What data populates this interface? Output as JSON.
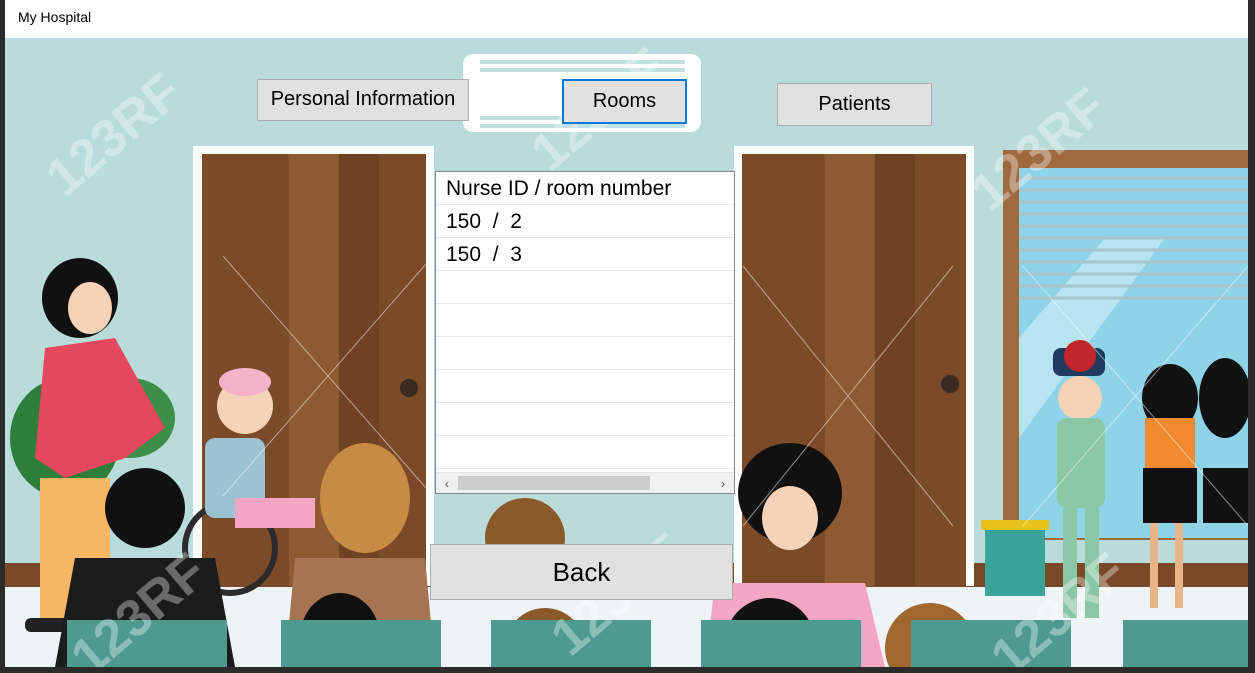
{
  "window": {
    "title": "My Hospital"
  },
  "nav": {
    "personal_label": "Personal Information",
    "rooms_label": "Rooms",
    "patients_label": "Patients"
  },
  "rooms_list": {
    "rows": [
      "Nurse ID / room number",
      "150  /  2",
      "150  /  3",
      "",
      "",
      "",
      "",
      "",
      ""
    ]
  },
  "back_label": "Back",
  "watermark": "123RF",
  "colors": {
    "selected_border": "#0078d7",
    "button_face": "#e1e1e1",
    "wall": "#b9dcdb"
  },
  "icons": {
    "scroll_left": "‹",
    "scroll_right": "›"
  }
}
